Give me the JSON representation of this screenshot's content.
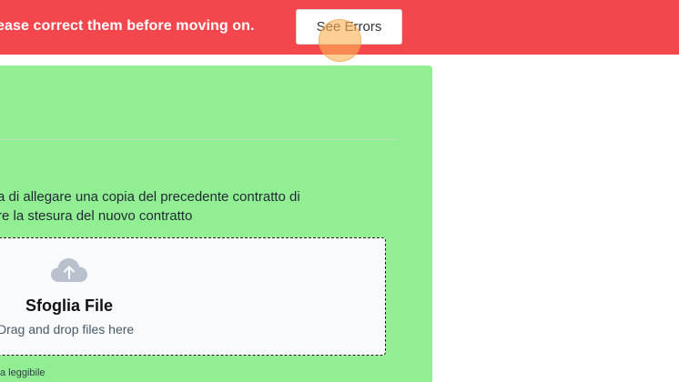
{
  "banner": {
    "message": "ease correct them before moving on.",
    "button_label": "See Errors",
    "background_color": "#f4474d"
  },
  "form": {
    "card_color": "#92ee93",
    "instruction_line1": "a di allegare una copia del precedente contratto di",
    "instruction_line2": "re la stesura del nuovo contratto",
    "upload": {
      "icon": "cloud-upload-icon",
      "title": "Sfoglia File",
      "hint": "Drag and drop files here"
    },
    "note": "a leggibile"
  }
}
